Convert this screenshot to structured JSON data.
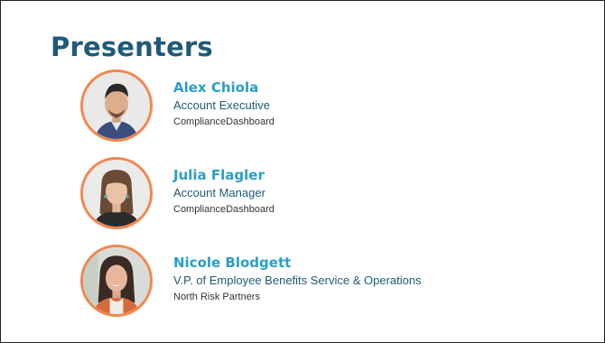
{
  "slide": {
    "title": "Presenters"
  },
  "presenters": [
    {
      "name": "Alex Chiola",
      "role": "Account Executive",
      "company": "ComplianceDashboard"
    },
    {
      "name": "Julia Flagler",
      "role": "Account Manager",
      "company": "ComplianceDashboard"
    },
    {
      "name": "Nicole Blodgett",
      "role": "V.P. of Employee Benefits Service & Operations",
      "company": "North Risk Partners"
    }
  ],
  "colors": {
    "title": "#1e5a78",
    "name": "#2a9ec8",
    "avatar_ring": "#f2874f"
  }
}
